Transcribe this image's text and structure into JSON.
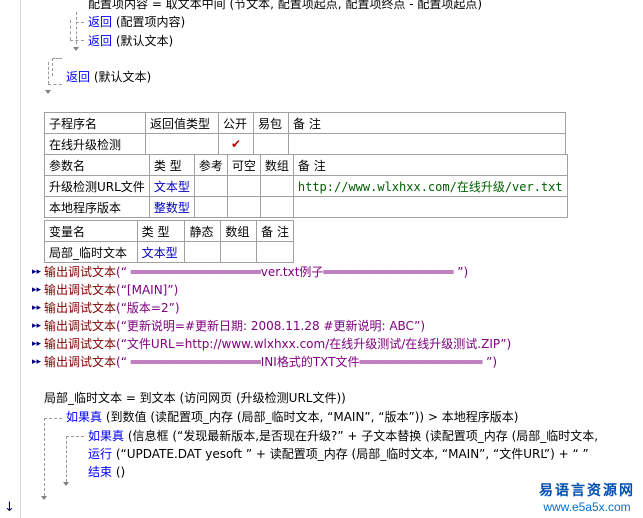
{
  "code_top": {
    "line1": "配置项内容 = 取文本中间 (节文本, 配置项起点, 配置项终点 - 配置项起点)",
    "line2_kw": "返回",
    "line2_rest": " (配置项内容)",
    "line3_kw": "返回",
    "line3_rest": " (默认文本)",
    "line4_kw": "返回",
    "line4_rest": " (默认文本)"
  },
  "sub_table": {
    "headers": [
      "子程序名",
      "返回值类型",
      "公开",
      "易包",
      "备 注"
    ],
    "row": {
      "name": "在线升级检测",
      "return_type": "",
      "public_mark": "✔",
      "easy_pkg": "",
      "note": ""
    },
    "param_headers": [
      "参数名",
      "类 型",
      "参考",
      "可空",
      "数组",
      "备 注"
    ],
    "params": [
      {
        "name": "升级检测URL文件",
        "type": "文本型",
        "ref": "",
        "nullable": "",
        "array": "",
        "note": "http://www.wlxhxx.com/在线升级/ver.txt"
      },
      {
        "name": "本地程序版本",
        "type": "整数型",
        "ref": "",
        "nullable": "",
        "array": "",
        "note": ""
      }
    ]
  },
  "var_table": {
    "headers": [
      "变量名",
      "类 型",
      "静态",
      "数组",
      "备 注"
    ],
    "rows": [
      {
        "name": "局部_临时文本",
        "type": "文本型",
        "static": "",
        "array": "",
        "note": ""
      }
    ]
  },
  "debug_lines": [
    {
      "fn": "输出调试文本",
      "arg": "(“ ══════════════════ver.txt例子══════════════════ ”)"
    },
    {
      "fn": "输出调试文本",
      "arg": "(“[MAIN]”)"
    },
    {
      "fn": "输出调试文本",
      "arg": "(“版本=2”)"
    },
    {
      "fn": "输出调试文本",
      "arg": "(“更新说明=#更新日期: 2008.11.28 #更新说明: ABC”)"
    },
    {
      "fn": "输出调试文本",
      "arg": "(“文件URL=http://www.wlxhxx.com/在线升级测试/在线升级测试.ZIP”)"
    },
    {
      "fn": "输出调试文本",
      "arg": "(“ ══════════════════INI格式的TXT文件═════════════════ ”)"
    }
  ],
  "code_bottom": {
    "assign": "局部_临时文本 = 到文本 (访问网页 (升级检测URL文件))",
    "if1_kw": "如果真",
    "if1_rest": " (到数值 (读配置项_内存 (局部_临时文本, “MAIN”, “版本”)) > 本地程序版本)",
    "if2_kw": "如果真",
    "if2_rest": " (信息框 (“发现最新版本,是否现在升级?” + 子文本替换 (读配置项_内存 (局部_临时文本,",
    "run_kw": "运行",
    "run_rest": " (“UPDATE.DAT yesoft ” + 读配置项_内存 (局部_临时文本, “MAIN”, “文件URL”) + “ ”",
    "end_kw": "结束",
    "end_rest": " ()"
  },
  "watermark": {
    "title": "易语言资源网",
    "url": "www.e5a5x.com"
  },
  "colors": {
    "keyword": "#0000ff",
    "function": "#800000",
    "string": "#800080",
    "link": "#0000c0"
  }
}
